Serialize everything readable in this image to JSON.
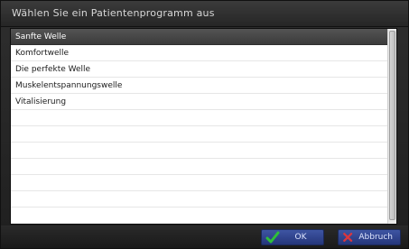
{
  "window": {
    "title": "Wählen Sie ein Patientenprogramm aus"
  },
  "list": {
    "selected_index": 0,
    "items": [
      "Sanfte Welle",
      "Komfortwelle",
      "Die perfekte Welle",
      "Muskelentspannungswelle",
      "Vitalisierung",
      "",
      "",
      "",
      "",
      "",
      "",
      ""
    ]
  },
  "buttons": {
    "ok_label": "OK",
    "cancel_label": "Abbruch",
    "ok_icon": "checkmark-icon",
    "cancel_icon": "close-icon"
  },
  "colors": {
    "ok_check": "#2fbf39",
    "cancel_x": "#d9363e",
    "selected_row": "#4a4a4a",
    "button_blue": "#2f4390"
  }
}
